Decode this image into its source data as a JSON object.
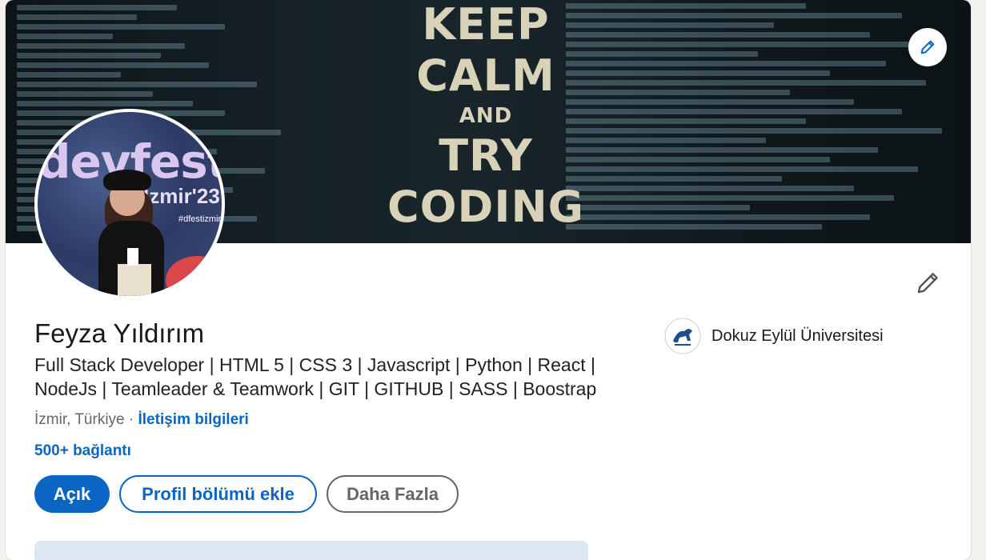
{
  "banner": {
    "line1": "KEEP",
    "line2": "CALM",
    "line3": "AND",
    "line4": "TRY",
    "line5": "CODING",
    "edit_icon": "pencil-icon"
  },
  "avatar": {
    "banner_word": "devfest",
    "banner_city": "İzmir'23",
    "hashtag": "#dfestizmir"
  },
  "profile": {
    "name": "Feyza Yıldırım",
    "headline": "Full Stack Developer | HTML 5 | CSS 3 | Javascript | Python | React | NodeJs | Teamleader & Teamwork | GIT | GITHUB | SASS | Boostrap",
    "location": "İzmir, Türkiye",
    "separator": " · ",
    "contact_info": "İletişim bilgileri",
    "connections": "500+ bağlantı",
    "edit_icon": "pencil-icon"
  },
  "actions": {
    "open": "Açık",
    "add_section": "Profil bölümü ekle",
    "more": "Daha Fazla"
  },
  "education": {
    "school": "Dokuz Eylül Üniversitesi"
  },
  "colors": {
    "accent": "#0a66c2",
    "text": "#191919",
    "muted": "#666666"
  }
}
